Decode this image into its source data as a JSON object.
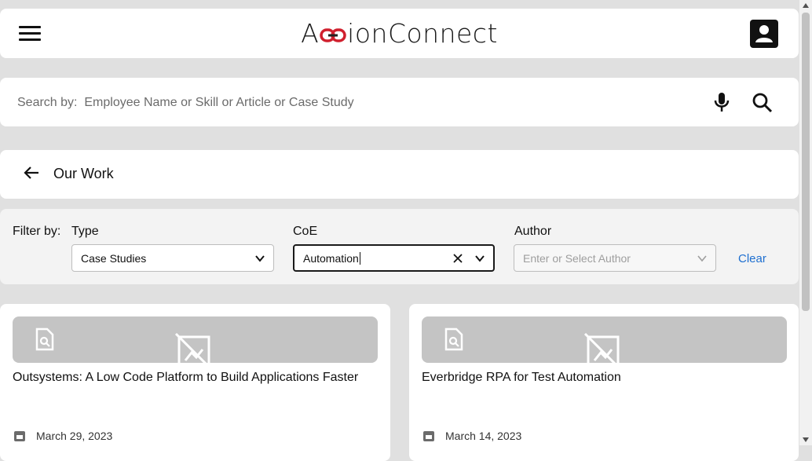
{
  "app": {
    "logo_prefix": "A",
    "logo_suffix": "ionConnect",
    "brand_color": "#d0202e"
  },
  "search": {
    "placeholder": "Search by:  Employee Name or Skill or Article or Case Study",
    "value": ""
  },
  "header": {
    "title": "Our Work"
  },
  "filters": {
    "filter_by_label": "Filter by:",
    "type": {
      "label": "Type",
      "value": "Case Studies"
    },
    "coe": {
      "label": "CoE",
      "value": "Automation"
    },
    "author": {
      "label": "Author",
      "placeholder": "Enter or Select Author"
    },
    "clear_label": "Clear"
  },
  "results": [
    {
      "title": "Outsystems: A Low Code Platform to Build Applications Faster",
      "date": "March 29, 2023"
    },
    {
      "title": "Everbridge RPA for Test Automation",
      "date": "March 14, 2023"
    }
  ],
  "icons": [
    "menu-icon",
    "profile-icon",
    "microphone-icon",
    "search-icon",
    "back-arrow-icon",
    "chevron-down-icon",
    "clear-x-icon",
    "document-search-icon",
    "no-image-icon",
    "calendar-icon"
  ]
}
